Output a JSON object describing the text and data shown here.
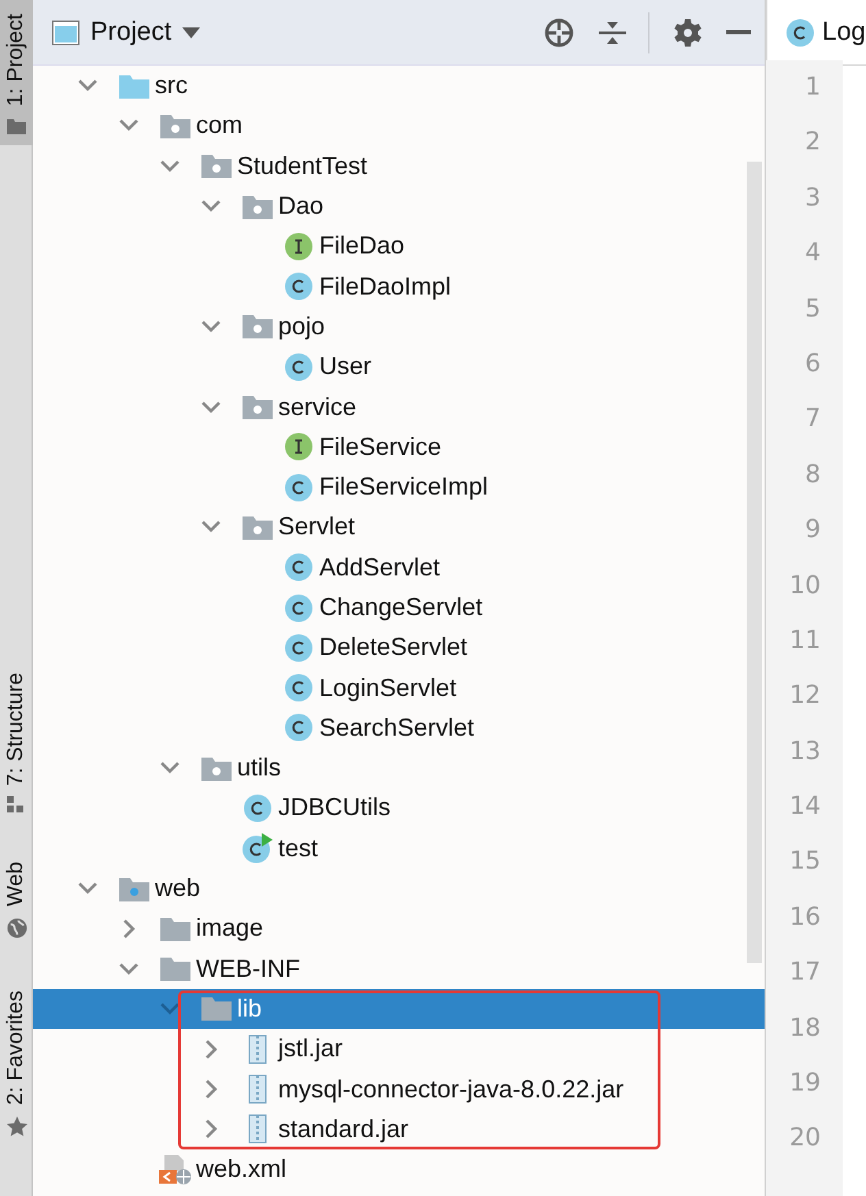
{
  "sidebar_tabs": [
    {
      "label": "1: Project",
      "kind": "project",
      "selected": true
    },
    {
      "label": "7: Structure",
      "kind": "structure",
      "selected": false
    },
    {
      "label": "Web",
      "kind": "web",
      "selected": false
    },
    {
      "label": "2: Favorites",
      "kind": "favorites",
      "selected": false
    }
  ],
  "project_panel": {
    "title": "Project",
    "tree": [
      {
        "label": "src",
        "kind": "source_root",
        "expanded": true,
        "selected": false,
        "children": [
          {
            "label": "com",
            "kind": "package",
            "expanded": true,
            "selected": false,
            "children": [
              {
                "label": "StudentTest",
                "kind": "package",
                "expanded": true,
                "selected": false,
                "children": [
                  {
                    "label": "Dao",
                    "kind": "package",
                    "expanded": true,
                    "selected": false,
                    "children": [
                      {
                        "label": "FileDao",
                        "kind": "interface",
                        "selected": false
                      },
                      {
                        "label": "FileDaoImpl",
                        "kind": "class",
                        "selected": false
                      }
                    ]
                  },
                  {
                    "label": "pojo",
                    "kind": "package",
                    "expanded": true,
                    "selected": false,
                    "children": [
                      {
                        "label": "User",
                        "kind": "class",
                        "selected": false
                      }
                    ]
                  },
                  {
                    "label": "service",
                    "kind": "package",
                    "expanded": true,
                    "selected": false,
                    "children": [
                      {
                        "label": "FileService",
                        "kind": "interface",
                        "selected": false
                      },
                      {
                        "label": "FileServiceImpl",
                        "kind": "class",
                        "selected": false
                      }
                    ]
                  },
                  {
                    "label": "Servlet",
                    "kind": "package",
                    "expanded": true,
                    "selected": false,
                    "children": [
                      {
                        "label": "AddServlet",
                        "kind": "class",
                        "selected": false
                      },
                      {
                        "label": "ChangeServlet",
                        "kind": "class",
                        "selected": false
                      },
                      {
                        "label": "DeleteServlet",
                        "kind": "class",
                        "selected": false
                      },
                      {
                        "label": "LoginServlet",
                        "kind": "class",
                        "selected": false
                      },
                      {
                        "label": "SearchServlet",
                        "kind": "class",
                        "selected": false
                      }
                    ]
                  }
                ]
              },
              {
                "label": "utils",
                "kind": "package",
                "expanded": true,
                "selected": false,
                "children": [
                  {
                    "label": "JDBCUtils",
                    "kind": "class",
                    "selected": false
                  },
                  {
                    "label": "test",
                    "kind": "main_class",
                    "selected": false
                  }
                ]
              }
            ]
          }
        ]
      },
      {
        "label": "web",
        "kind": "web_root",
        "expanded": true,
        "selected": false,
        "children": [
          {
            "label": "image",
            "kind": "folder",
            "expanded": false,
            "selected": false
          },
          {
            "label": "WEB-INF",
            "kind": "folder",
            "expanded": true,
            "selected": false,
            "children": [
              {
                "label": "lib",
                "kind": "folder",
                "expanded": true,
                "selected": true,
                "children": [
                  {
                    "label": "jstl.jar",
                    "kind": "jar",
                    "expanded": false,
                    "selected": false
                  },
                  {
                    "label": "mysql-connector-java-8.0.22.jar",
                    "kind": "jar",
                    "expanded": false,
                    "selected": false
                  },
                  {
                    "label": "standard.jar",
                    "kind": "jar",
                    "expanded": false,
                    "selected": false
                  }
                ]
              }
            ]
          },
          {
            "label": "web.xml",
            "kind": "xml",
            "selected": false
          }
        ]
      }
    ]
  },
  "editor": {
    "tab": "Log",
    "line_numbers": [
      "1",
      "2",
      "3",
      "4",
      "5",
      "6",
      "7",
      "8",
      "9",
      "10",
      "11",
      "12",
      "13",
      "14",
      "15",
      "16",
      "17",
      "18",
      "19",
      "20"
    ]
  }
}
